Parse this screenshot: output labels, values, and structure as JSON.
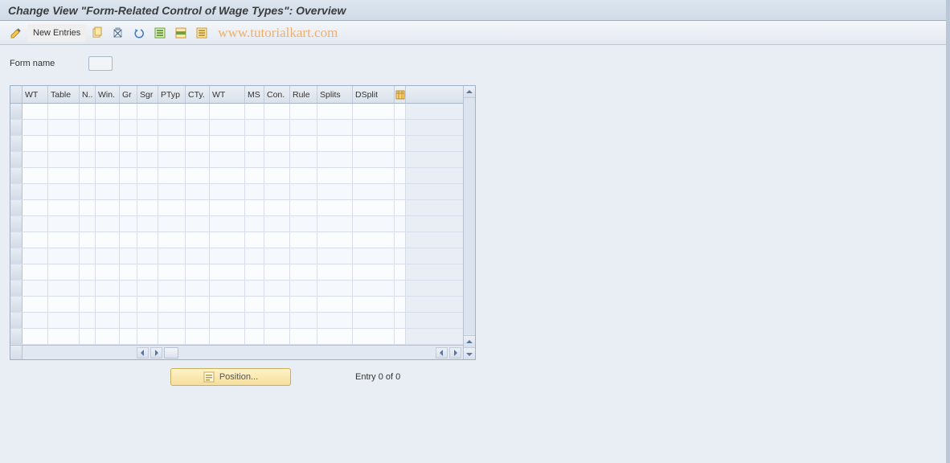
{
  "title": "Change View \"Form-Related Control of Wage Types\": Overview",
  "toolbar": {
    "new_entries": "New Entries"
  },
  "watermark": "www.tutorialkart.com",
  "form": {
    "form_name_label": "Form name",
    "form_name_value": ""
  },
  "grid": {
    "columns": {
      "wt": "WT",
      "table": "Table",
      "n": "N..",
      "win": "Win.",
      "gr": "Gr",
      "sgr": "Sgr",
      "ptyp": "PTyp",
      "cty": "CTy.",
      "wt2": "WT",
      "ms": "MS",
      "con": "Con.",
      "rule": "Rule",
      "splits": "Splits",
      "dsplit": "DSplit"
    },
    "row_count": 15,
    "rows": []
  },
  "footer": {
    "position_label": "Position...",
    "entry_text": "Entry 0 of 0"
  }
}
